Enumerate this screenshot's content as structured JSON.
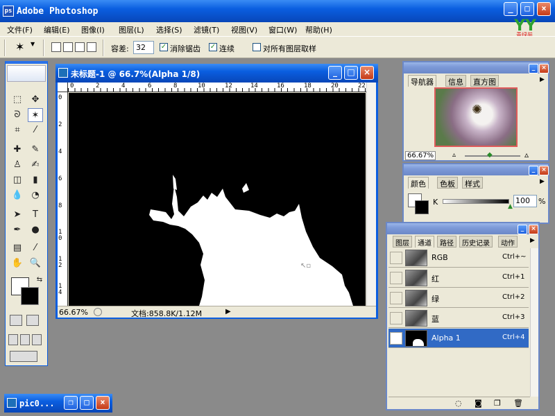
{
  "app": {
    "title": "Adobe Photoshop",
    "logo": "ps"
  },
  "brand": {
    "logo": "YY",
    "sub": "青绿苑"
  },
  "menu": [
    {
      "label": "文件(F)"
    },
    {
      "label": "编辑(E)"
    },
    {
      "label": "图像(I)"
    },
    {
      "label": "图层(L)"
    },
    {
      "label": "选择(S)"
    },
    {
      "label": "滤镜(T)"
    },
    {
      "label": "视图(V)"
    },
    {
      "label": "窗口(W)"
    },
    {
      "label": "帮助(H)"
    }
  ],
  "options": {
    "tolerance_label": "容差:",
    "tolerance_value": "32",
    "antialias_label": "消除锯齿",
    "antialias_checked": true,
    "contiguous_label": "连续",
    "contiguous_checked": true,
    "sample_all_label": "对所有图层取样",
    "sample_all_checked": false
  },
  "document": {
    "title": "未标题-1 @ 66.7%(Alpha 1/8)",
    "zoom": "66.67%",
    "doc_size": "文档:858.8K/1.12M",
    "ruler_h": [
      "0",
      "2",
      "4",
      "6",
      "8",
      "10",
      "12",
      "14",
      "16",
      "18",
      "20",
      "22"
    ],
    "ruler_v": [
      "0",
      "2",
      "4",
      "6",
      "8",
      "10",
      "12",
      "14"
    ]
  },
  "navigator": {
    "tabs": [
      "导航器",
      "信息",
      "直方图"
    ],
    "zoom": "66.67%"
  },
  "color": {
    "tabs": [
      "颜色",
      "色板",
      "样式"
    ],
    "channel_label": "K",
    "value": "100",
    "unit": "%"
  },
  "channels": {
    "tabs": [
      "图层",
      "通道",
      "路径",
      "历史记录",
      "动作"
    ],
    "rows": [
      {
        "name": "RGB",
        "key": "Ctrl+~",
        "visible": false,
        "selected": false
      },
      {
        "name": "红",
        "key": "Ctrl+1",
        "visible": false,
        "selected": false
      },
      {
        "name": "绿",
        "key": "Ctrl+2",
        "visible": false,
        "selected": false
      },
      {
        "name": "蓝",
        "key": "Ctrl+3",
        "visible": false,
        "selected": false
      },
      {
        "name": "Alpha 1",
        "key": "Ctrl+4",
        "visible": true,
        "selected": true
      }
    ]
  },
  "minimized": {
    "title": "pic0..."
  },
  "colors": {
    "title_active": "#0a5ee0",
    "selection": "#316ac5",
    "panel": "#ece9d8",
    "desktop": "#8a8a8a"
  }
}
